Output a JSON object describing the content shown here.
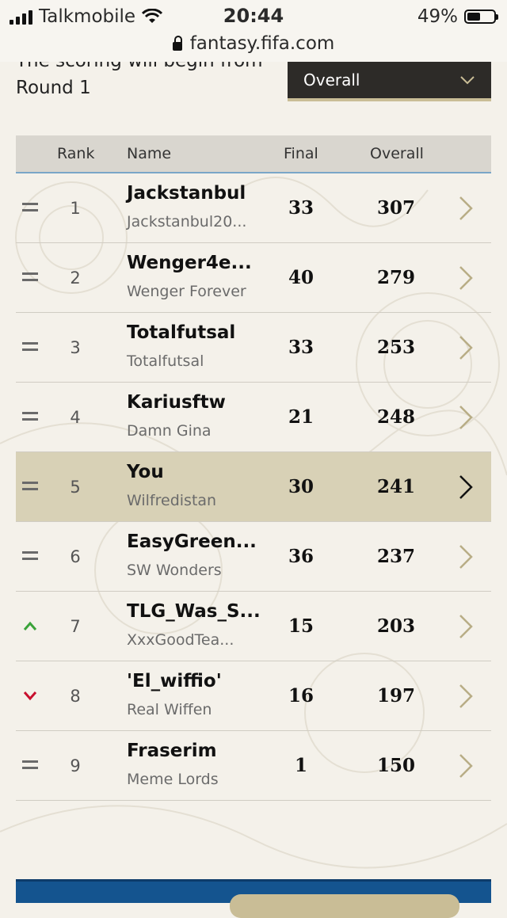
{
  "status": {
    "carrier": "Talkmobile",
    "time": "20:44",
    "battery": "49%",
    "url": "fantasy.fifa.com"
  },
  "scoring": {
    "line1": "The scoring will begin from",
    "line2": "Round 1"
  },
  "dropdown": {
    "label": "Overall"
  },
  "table": {
    "headers": {
      "rank": "Rank",
      "name": "Name",
      "final": "Final",
      "overall": "Overall"
    },
    "rows": [
      {
        "movement": "same",
        "rank": "1",
        "team": "Jackstanbul",
        "user": "Jackstanbul20...",
        "final": "33",
        "overall": "307"
      },
      {
        "movement": "same",
        "rank": "2",
        "team": "Wenger4e...",
        "user": "Wenger Forever",
        "final": "40",
        "overall": "279"
      },
      {
        "movement": "same",
        "rank": "3",
        "team": "Totalfutsal",
        "user": "Totalfutsal",
        "final": "33",
        "overall": "253"
      },
      {
        "movement": "same",
        "rank": "4",
        "team": "Kariusftw",
        "user": "Damn Gina",
        "final": "21",
        "overall": "248"
      },
      {
        "movement": "same",
        "rank": "5",
        "team": "You",
        "user": "Wilfredistan",
        "final": "30",
        "overall": "241",
        "highlight": true
      },
      {
        "movement": "same",
        "rank": "6",
        "team": "EasyGreen...",
        "user": "SW Wonders",
        "final": "36",
        "overall": "237"
      },
      {
        "movement": "up",
        "rank": "7",
        "team": "TLG_Was_S...",
        "user": "XxxGoodTea...",
        "final": "15",
        "overall": "203"
      },
      {
        "movement": "down",
        "rank": "8",
        "team": "'El_wiffio'",
        "user": "Real Wiffen",
        "final": "16",
        "overall": "197"
      },
      {
        "movement": "same",
        "rank": "9",
        "team": "Fraserim",
        "user": "Meme Lords",
        "final": "1",
        "overall": "150"
      }
    ]
  },
  "colors": {
    "up": "#3aa33a",
    "down": "#c8102e",
    "highlight": "#d8d1b6",
    "chevron": "#b8ad86"
  }
}
